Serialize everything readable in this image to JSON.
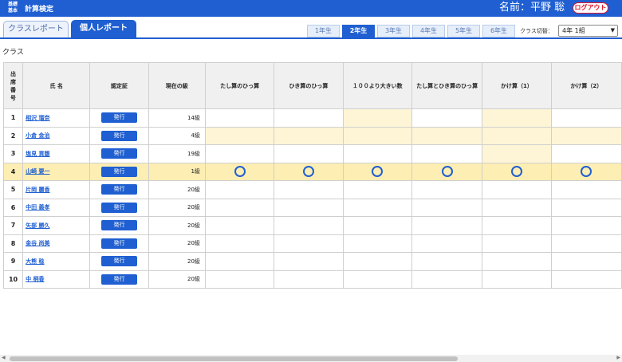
{
  "header": {
    "logo": "基礎\n基本",
    "title": "計算検定",
    "user": "名前：平野 聡",
    "logout": "ログアウト"
  },
  "tabs": {
    "class_report": "クラスレポート",
    "personal_report": "個人レポート"
  },
  "grades": [
    "1年生",
    "2年生",
    "3年生",
    "4年生",
    "5年生",
    "6年生"
  ],
  "active_grade": 1,
  "class_switch": {
    "label": "クラス切替：",
    "value": "4年 1組"
  },
  "section_label": "クラス",
  "table": {
    "headers": [
      "出\n席\n番\n号",
      "氏 名",
      "認定証",
      "現在の級",
      "たし算のひっ算",
      "ひき算のひっ算",
      "１００より大きい数",
      "たし算とひき算のひっ算",
      "かけ算（1）",
      "かけ算（2）"
    ],
    "issue_label": "発行",
    "rows": [
      {
        "no": "1",
        "name": "相沢 瑠奈",
        "level": "14級",
        "marks": [
          "",
          "",
          "",
          "",
          "",
          ""
        ]
      },
      {
        "no": "2",
        "name": "小倉 金治",
        "level": "4級",
        "marks": [
          "",
          "",
          "",
          "",
          "",
          ""
        ]
      },
      {
        "no": "3",
        "name": "塩見 貢馥",
        "level": "19級",
        "marks": [
          "",
          "",
          "",
          "",
          "",
          ""
        ]
      },
      {
        "no": "4",
        "name": "山崎 要一",
        "level": "1級",
        "marks": [
          "○",
          "○",
          "○",
          "○",
          "○",
          "○"
        ]
      },
      {
        "no": "5",
        "name": "片岡 麗香",
        "level": "20級",
        "marks": [
          "",
          "",
          "",
          "",
          "",
          ""
        ]
      },
      {
        "no": "6",
        "name": "中田 義孝",
        "level": "20級",
        "marks": [
          "",
          "",
          "",
          "",
          "",
          ""
        ]
      },
      {
        "no": "7",
        "name": "矢部 勝久",
        "level": "20級",
        "marks": [
          "",
          "",
          "",
          "",
          "",
          ""
        ]
      },
      {
        "no": "8",
        "name": "金谷 尚美",
        "level": "20級",
        "marks": [
          "",
          "",
          "",
          "",
          "",
          ""
        ]
      },
      {
        "no": "9",
        "name": "大熊 稔",
        "level": "20級",
        "marks": [
          "",
          "",
          "",
          "",
          "",
          ""
        ]
      },
      {
        "no": "10",
        "name": "中 柄香",
        "level": "20級",
        "marks": [
          "",
          "",
          "",
          "",
          "",
          ""
        ]
      }
    ]
  },
  "colors": {
    "primary": "#1f5fd1",
    "logout": "#e0182d",
    "highlight": "#fef5d6",
    "row_highlight": "#fdeeb3"
  }
}
